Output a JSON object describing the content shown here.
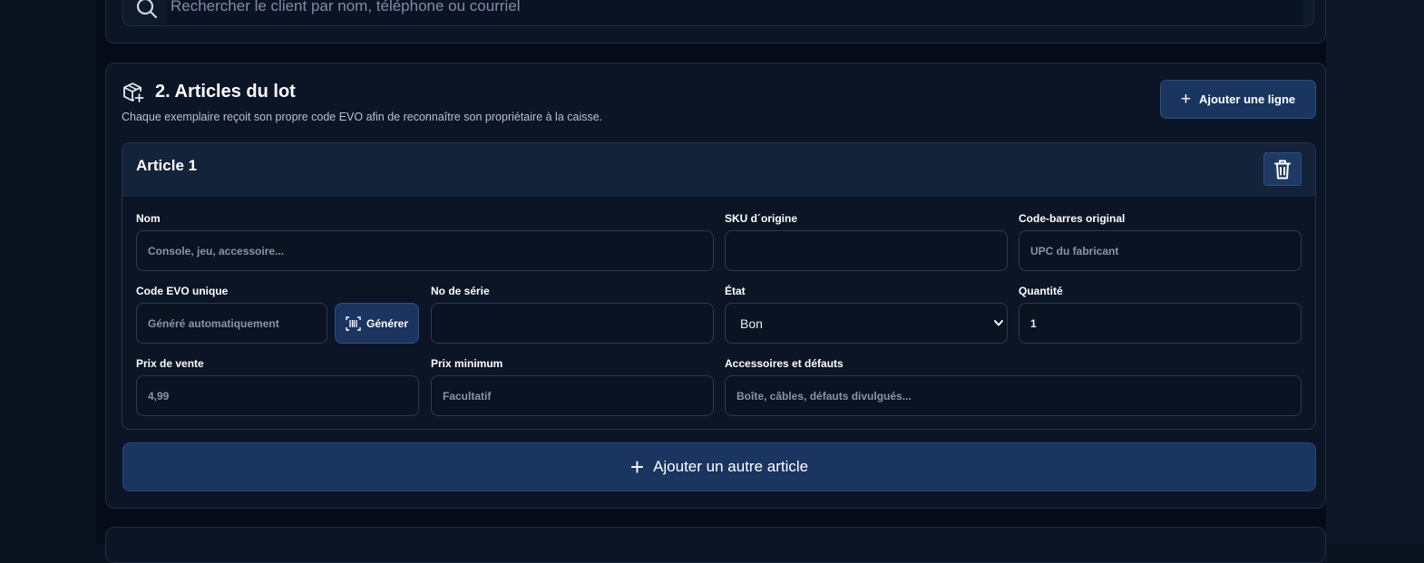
{
  "search": {
    "placeholder": "Rechercher le client par nom, téléphone ou courriel",
    "icon": "search-icon"
  },
  "section": {
    "number_title": "2. Articles du lot",
    "description": "Chaque exemplaire reçoit son propre code EVO afin de reconnaître son propriétaire à la caisse.",
    "icon": "package-plus-icon",
    "add_line_label": "Ajouter une ligne"
  },
  "article": {
    "title": "Article 1",
    "delete_icon": "trash-icon",
    "fields": {
      "nom": {
        "label": "Nom",
        "placeholder": "Console, jeu, accessoire..."
      },
      "sku": {
        "label": "SKU d´origine",
        "value": ""
      },
      "barcode": {
        "label": "Code-barres original",
        "placeholder": "UPC du fabricant"
      },
      "evo": {
        "label": "Code EVO unique",
        "placeholder": "Généré automatiquement",
        "generate_label": "Générer"
      },
      "serial": {
        "label": "No de série",
        "value": ""
      },
      "etat": {
        "label": "État",
        "selected": "Bon"
      },
      "quantite": {
        "label": "Quantité",
        "value": "1"
      },
      "prix_vente": {
        "label": "Prix de vente",
        "placeholder": "4,99"
      },
      "prix_min": {
        "label": "Prix minimum",
        "placeholder": "Facultatif"
      },
      "accessoires": {
        "label": "Accessoires et défauts",
        "placeholder": "Boîte, câbles, défauts divulgués..."
      }
    }
  },
  "add_article_label": "Ajouter un autre article",
  "colors": {
    "background": "#060c17",
    "card": "#0b1526",
    "accent": "#1a3560",
    "border": "#1f2c40"
  }
}
